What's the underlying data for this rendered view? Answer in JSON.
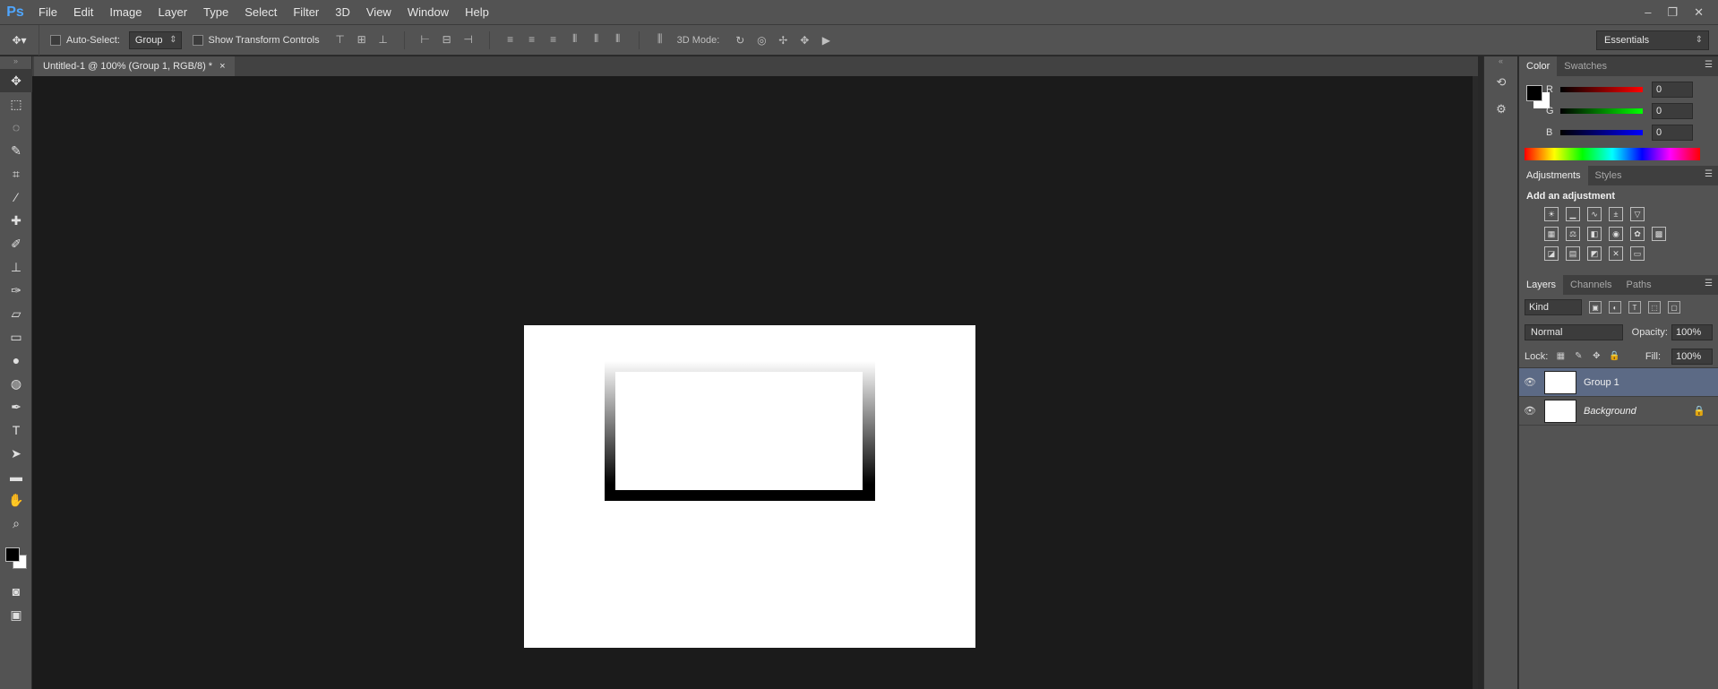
{
  "menubar": {
    "logo": "Ps",
    "items": [
      "File",
      "Edit",
      "Image",
      "Layer",
      "Type",
      "Select",
      "Filter",
      "3D",
      "View",
      "Window",
      "Help"
    ],
    "window_controls": [
      "–",
      "❐",
      "✕"
    ]
  },
  "options": {
    "auto_select_label": "Auto-Select:",
    "auto_select_mode": "Group",
    "show_transform_label": "Show Transform Controls",
    "mode3d_label": "3D Mode:",
    "workspace": "Essentials"
  },
  "document_tab": {
    "title": "Untitled-1 @ 100% (Group 1, RGB/8) *",
    "close": "×"
  },
  "color_panel": {
    "tabs": [
      "Color",
      "Swatches"
    ],
    "r_label": "R",
    "g_label": "G",
    "b_label": "B",
    "r_value": "0",
    "g_value": "0",
    "b_value": "0"
  },
  "adjustments_panel": {
    "tabs": [
      "Adjustments",
      "Styles"
    ],
    "title": "Add an adjustment"
  },
  "layers_panel": {
    "tabs": [
      "Layers",
      "Channels",
      "Paths"
    ],
    "kind": "Kind",
    "blend_mode": "Normal",
    "opacity_label": "Opacity:",
    "opacity_value": "100%",
    "lock_label": "Lock:",
    "fill_label": "Fill:",
    "fill_value": "100%",
    "layers": [
      {
        "name": "Group 1",
        "selected": true
      },
      {
        "name": "Background",
        "locked": true
      }
    ]
  },
  "colors": {
    "foreground": "#000000",
    "background": "#ffffff",
    "selection": "#5c6a85"
  }
}
